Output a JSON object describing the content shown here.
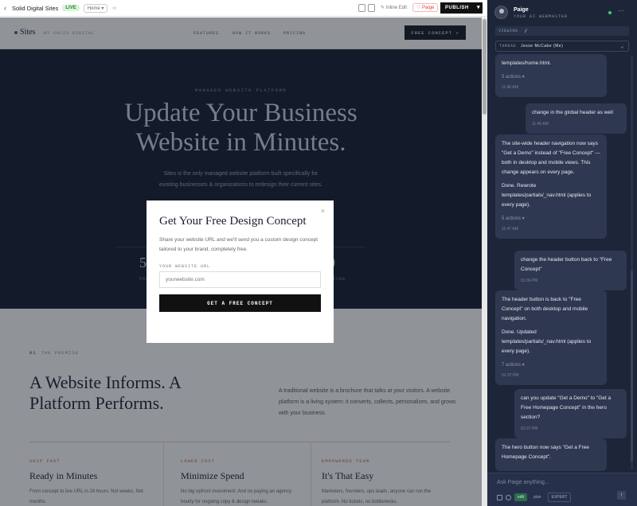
{
  "toolbar": {
    "back_icon": "chevron-left-icon",
    "site_title": "Solid Digital Sites",
    "live_badge": "LIVE",
    "page_select": "Home ▾",
    "code_icon": "‹›",
    "inline_edit": "✎ Inline Edit",
    "paige_button": "♡ Paige",
    "publish_label": "PUBLISH",
    "publish_chevron": "▾"
  },
  "site": {
    "logo_text": "Sites",
    "logo_sub": "BY SOLID DIGITAL",
    "nav": [
      "FEATURES",
      "HOW IT WORKS",
      "PRICING"
    ],
    "nav_cta": "FREE CONCEPT ↗",
    "hero": {
      "eyebrow": "MANAGED WEBSITE PLATFORM",
      "title_line1": "Update Your Business",
      "title_line2": "Website in Minutes.",
      "paragraph_line1": "Sites is the only managed website platform built specifically for",
      "paragraph_line2": "existing businesses & organizations to redesign their current sites."
    },
    "stats": [
      {
        "value": "5",
        "label": "PRO"
      },
      {
        "value": "0",
        "label": "TING"
      }
    ],
    "section": {
      "num": "01",
      "eyebrow": "THE PREMISE",
      "title": "A Website Informs. A Platform Performs.",
      "paragraph": "A traditional website is a brochure that talks at your visitors. A website platform is a living system: it converts, collects, personalizes, and grows with your business."
    },
    "features": [
      {
        "eyebrow": "SHIP FAST",
        "title": "Ready in Minutes",
        "text": "From concept to live URL in 24 hours. Not weeks. Not months."
      },
      {
        "eyebrow": "LOWER COST",
        "title": "Minimize Spend",
        "text": "No big upfront investment. And no paying an agency hourly for ongoing copy & design tweaks."
      },
      {
        "eyebrow": "EMPOWERED TEAM",
        "title": "It's That Easy",
        "text": "Marketers, founders, ops leads, anyone can run the platform. No tickets, no bottlenecks."
      }
    ]
  },
  "modal": {
    "close": "×",
    "title": "Get Your Free Design Concept",
    "description": "Share your website URL and we'll send you a custom design concept tailored to your brand, completely free.",
    "url_label": "YOUR WEBSITE URL",
    "url_placeholder": "yourwebsite.com",
    "button": "GET A FREE CONCEPT"
  },
  "chat": {
    "name": "Paige",
    "subtitle": "YOUR AI WEBMASTER",
    "more_icon": "···",
    "viewing_label": "VIEWING",
    "viewing_value": "/",
    "thread_label": "THREAD",
    "thread_value": "Jesse McCabe (Me)",
    "messages": [
      {
        "role": "assistant",
        "paragraphs": [
          "templates/home.html."
        ],
        "actions": "5 actions ▾",
        "time": "11:46 AM"
      },
      {
        "role": "user",
        "text": "change in the global header as well",
        "time": "11:46 AM"
      },
      {
        "role": "assistant",
        "paragraphs": [
          "The site-wide header navigation now says \"Get a Demo\" instead of \"Free Concept\" — both in desktop and mobile views. This change appears on every page.",
          "Done. Rewrote templates/partials/_nav.html (applies to every page)."
        ],
        "actions": "5 actions ▾",
        "time": "11:47 AM"
      },
      {
        "role": "user",
        "text": "change the header button back to \"Free Concept\"",
        "time": "01:36 PM"
      },
      {
        "role": "assistant",
        "paragraphs": [
          "The header button is back to \"Free Concept\" on both desktop and mobile navigation.",
          "Done. Updated templates/partials/_nav.html (applies to every page)."
        ],
        "actions": "7 actions ▾",
        "time": "01:37 PM"
      },
      {
        "role": "user",
        "text": "can you update \"Get a Demo\" to \"Get a Free Homepage Concept\" in the hero section?",
        "time": "01:37 PM"
      },
      {
        "role": "assistant",
        "paragraphs": [
          "The hero button now says \"Get a Free Homepage Concept\"."
        ],
        "actions": "",
        "time": ""
      }
    ],
    "input_placeholder": "Ask Paige anything...",
    "mode_edit": "edit",
    "mode_plan": "plan",
    "mode_expert": "EXPERT",
    "send_icon": "↑"
  },
  "colors": {
    "hero_bg": "#131a2a",
    "chat_bg": "#1d2638",
    "accent_orange": "#c0573a",
    "live_green": "#2a8a2a"
  }
}
